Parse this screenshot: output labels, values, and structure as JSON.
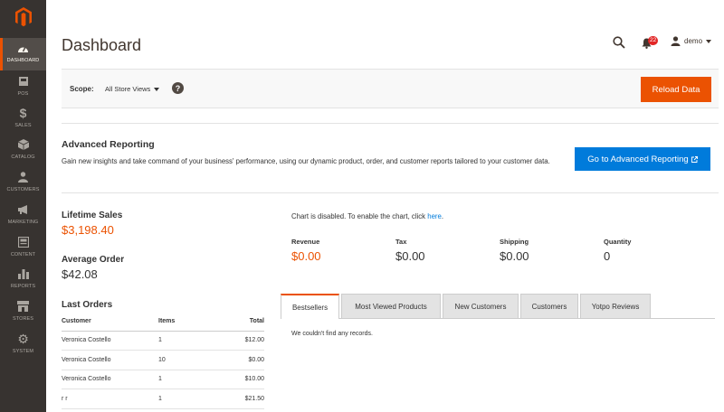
{
  "sidebar": {
    "items": [
      {
        "label": "DASHBOARD",
        "icon": "dashboard-icon"
      },
      {
        "label": "POS",
        "icon": "pos-icon"
      },
      {
        "label": "SALES",
        "icon": "dollar-icon"
      },
      {
        "label": "CATALOG",
        "icon": "box-icon"
      },
      {
        "label": "CUSTOMERS",
        "icon": "customers-icon"
      },
      {
        "label": "MARKETING",
        "icon": "megaphone-icon"
      },
      {
        "label": "CONTENT",
        "icon": "content-icon"
      },
      {
        "label": "REPORTS",
        "icon": "bar-chart-icon"
      },
      {
        "label": "STORES",
        "icon": "store-icon"
      },
      {
        "label": "SYSTEM",
        "icon": "gear-icon"
      }
    ]
  },
  "header": {
    "title": "Dashboard",
    "notifications_count": "22",
    "user_name": "demo"
  },
  "scope": {
    "label": "Scope:",
    "value": "All Store Views",
    "reload_label": "Reload Data"
  },
  "advanced": {
    "title": "Advanced Reporting",
    "description": "Gain new insights and take command of your business' performance, using our dynamic product, order, and customer reports tailored to your customer data.",
    "button_label": "Go to Advanced Reporting"
  },
  "stats": {
    "lifetime_label": "Lifetime Sales",
    "lifetime_value": "$3,198.40",
    "average_label": "Average Order",
    "average_value": "$42.08"
  },
  "last_orders": {
    "title": "Last Orders",
    "headers": {
      "customer": "Customer",
      "items": "Items",
      "total": "Total"
    },
    "rows": [
      {
        "customer": "Veronica Costello",
        "items": "1",
        "total": "$12.00"
      },
      {
        "customer": "Veronica Costello",
        "items": "10",
        "total": "$0.00"
      },
      {
        "customer": "Veronica Costello",
        "items": "1",
        "total": "$10.00"
      },
      {
        "customer": "r r",
        "items": "1",
        "total": "$21.50"
      }
    ]
  },
  "chart": {
    "message": "Chart is disabled. To enable the chart, click ",
    "link": "here",
    "period": "."
  },
  "metrics": {
    "revenue_label": "Revenue",
    "revenue_value": "$0.00",
    "tax_label": "Tax",
    "tax_value": "$0.00",
    "shipping_label": "Shipping",
    "shipping_value": "$0.00",
    "quantity_label": "Quantity",
    "quantity_value": "0"
  },
  "tabs": {
    "items": [
      "Bestsellers",
      "Most Viewed Products",
      "New Customers",
      "Customers",
      "Yotpo Reviews"
    ],
    "empty_message": "We couldn't find any records."
  },
  "colors": {
    "accent": "#eb5202",
    "link": "#007bdb",
    "sidebar": "#373330"
  }
}
